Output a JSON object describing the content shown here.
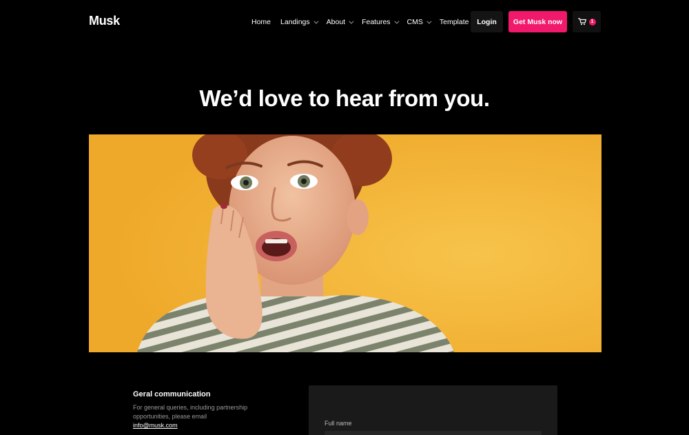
{
  "header": {
    "logo": "Musk",
    "nav": [
      {
        "label": "Home",
        "has_dropdown": false
      },
      {
        "label": "Landings",
        "has_dropdown": true
      },
      {
        "label": "About",
        "has_dropdown": true
      },
      {
        "label": "Features",
        "has_dropdown": true
      },
      {
        "label": "CMS",
        "has_dropdown": true
      },
      {
        "label": "Template",
        "has_dropdown": true
      }
    ],
    "login_label": "Login",
    "cta_label": "Get Musk now",
    "cart_icon": "cart-icon",
    "cart_count": "1"
  },
  "hero": {
    "title": "We’d love to hear from you."
  },
  "contact": {
    "title": "Geral communication",
    "text": "For general queries, including partnership opportunities, please email",
    "email": "info@musk.com"
  },
  "form": {
    "full_name_label": "Full name",
    "full_name_value": ""
  },
  "colors": {
    "background": "#000000",
    "accent": "#f0196b",
    "hero_background": "#f2b12e"
  }
}
